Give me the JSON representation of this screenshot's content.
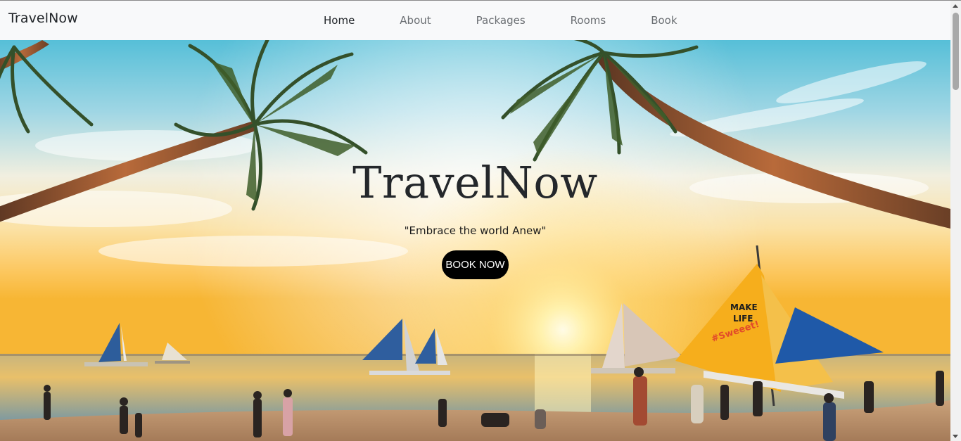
{
  "navbar": {
    "brand": "TravelNow",
    "links": [
      {
        "label": "Home",
        "active": true
      },
      {
        "label": "About",
        "active": false
      },
      {
        "label": "Packages",
        "active": false
      },
      {
        "label": "Rooms",
        "active": false
      },
      {
        "label": "Book",
        "active": false
      }
    ]
  },
  "hero": {
    "title": "TravelNow",
    "tagline": "\"Embrace the world Anew\"",
    "button_label": "BOOK NOW",
    "background": "tropical-beach-sunset-photo"
  },
  "sail_text": {
    "line1": "MAKE",
    "line2": "LIFE",
    "line3": "#Sweeet!"
  },
  "colors": {
    "navbar_bg": "#f8f9fa",
    "button_bg": "#000000",
    "button_text": "#ffffff",
    "title_color": "#24272b"
  }
}
